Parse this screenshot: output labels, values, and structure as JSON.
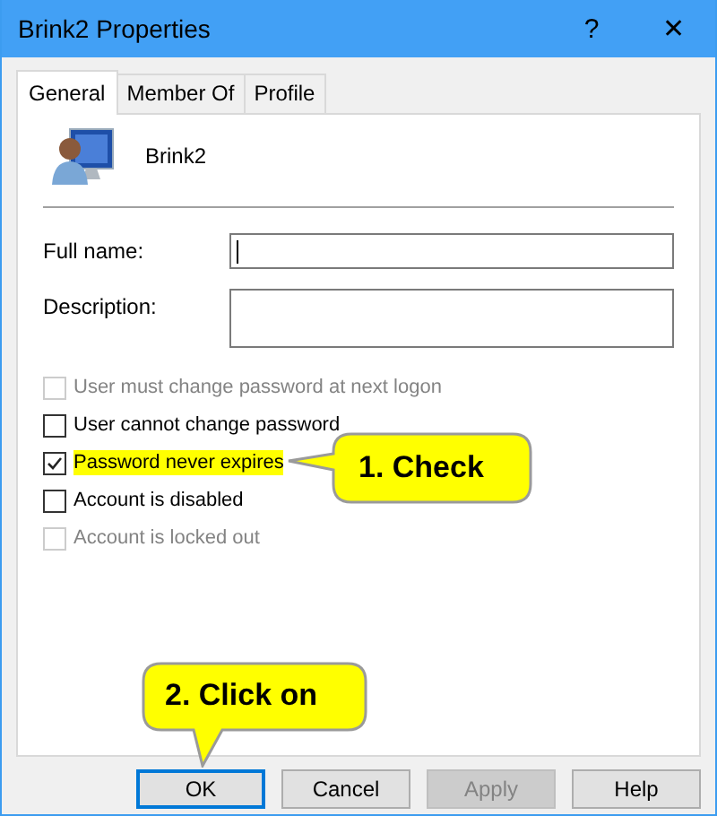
{
  "window": {
    "title": "Brink2 Properties",
    "help": "?",
    "close": "✕"
  },
  "tabs": [
    {
      "label": "General",
      "selected": true
    },
    {
      "label": "Member Of",
      "selected": false
    },
    {
      "label": "Profile",
      "selected": false
    }
  ],
  "user": {
    "name": "Brink2"
  },
  "fields": [
    {
      "label": "Full name:",
      "kind": "line",
      "focused": true
    },
    {
      "label": "Description:",
      "kind": "area",
      "focused": false
    }
  ],
  "options": [
    {
      "label": "User must change password at next logon",
      "checked": false,
      "disabled": true,
      "highlighted": false
    },
    {
      "label": "User cannot change password",
      "checked": false,
      "disabled": false,
      "highlighted": false
    },
    {
      "label": "Password never expires",
      "checked": true,
      "disabled": false,
      "highlighted": true
    },
    {
      "label": "Account is disabled",
      "checked": false,
      "disabled": false,
      "highlighted": false
    },
    {
      "label": "Account is locked out",
      "checked": false,
      "disabled": true,
      "highlighted": false
    }
  ],
  "buttons": [
    {
      "label": "OK",
      "default": true,
      "disabled": false
    },
    {
      "label": "Cancel",
      "default": false,
      "disabled": false
    },
    {
      "label": "Apply",
      "default": false,
      "disabled": true
    },
    {
      "label": "Help",
      "default": false,
      "disabled": false
    }
  ],
  "callouts": [
    {
      "text": "1. Check",
      "kind": "left"
    },
    {
      "text": "2. Click on",
      "kind": "down"
    }
  ]
}
